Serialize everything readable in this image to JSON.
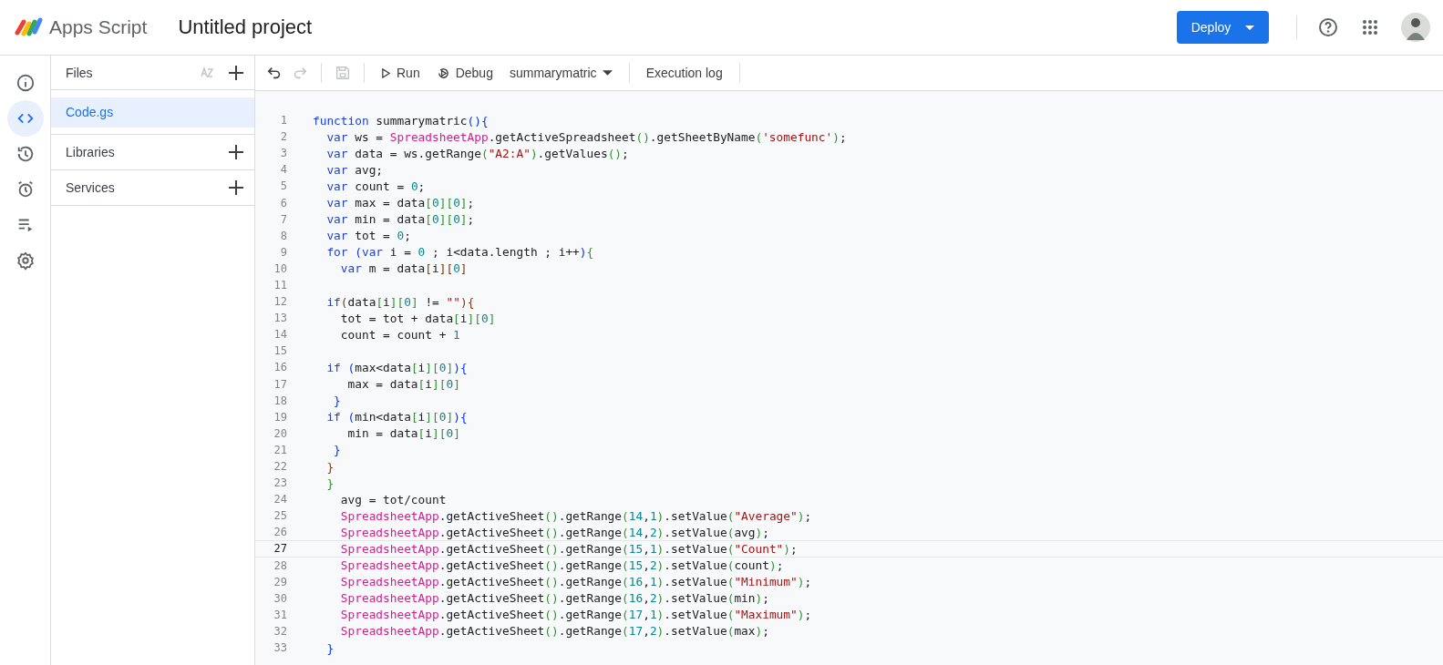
{
  "header": {
    "app_name": "Apps Script",
    "project_title": "Untitled project",
    "deploy_button": "Deploy"
  },
  "rail": [
    {
      "kind": "info",
      "selected": false
    },
    {
      "kind": "code",
      "selected": true
    },
    {
      "kind": "history",
      "selected": false
    },
    {
      "kind": "alarm",
      "selected": false
    },
    {
      "kind": "executions",
      "selected": false
    },
    {
      "kind": "settings",
      "selected": false
    }
  ],
  "files_panel": {
    "title": "Files",
    "files": [
      {
        "name": "Code.gs",
        "selected": true
      }
    ],
    "sections": [
      "Libraries",
      "Services"
    ]
  },
  "toolbar": {
    "undo_disabled": false,
    "redo_disabled": true,
    "save_disabled": true,
    "run": "Run",
    "debug": "Debug",
    "function": "summarymatric",
    "execution_log": "Execution log"
  },
  "code_lines": [
    {
      "number": "1",
      "current": false,
      "tokens": [
        {
          "kind": "keyword",
          "text": "function"
        },
        {
          "kind": "plain",
          "text": " summarymatric"
        },
        {
          "kind": "bracket2",
          "text": "(){"
        }
      ]
    },
    {
      "number": "2",
      "current": false,
      "tokens": [
        {
          "kind": "keyword",
          "text": "  var"
        },
        {
          "kind": "plain",
          "text": " ws = "
        },
        {
          "kind": "class",
          "text": "SpreadsheetApp"
        },
        {
          "kind": "plain",
          "text": ".getActiveSpreadsheet"
        },
        {
          "kind": "bracket1",
          "text": "()"
        },
        {
          "kind": "plain",
          "text": ".getSheetByName"
        },
        {
          "kind": "bracket1",
          "text": "("
        },
        {
          "kind": "string",
          "text": "'somefunc'"
        },
        {
          "kind": "bracket1",
          "text": ")"
        },
        {
          "kind": "plain",
          "text": ";"
        }
      ]
    },
    {
      "number": "3",
      "current": false,
      "tokens": [
        {
          "kind": "keyword",
          "text": "  var"
        },
        {
          "kind": "plain",
          "text": " data = ws.getRange"
        },
        {
          "kind": "bracket1",
          "text": "("
        },
        {
          "kind": "string",
          "text": "\"A2:A\""
        },
        {
          "kind": "bracket1",
          "text": ")"
        },
        {
          "kind": "plain",
          "text": ".getValues"
        },
        {
          "kind": "bracket1",
          "text": "()"
        },
        {
          "kind": "plain",
          "text": ";"
        }
      ]
    },
    {
      "number": "4",
      "current": false,
      "tokens": [
        {
          "kind": "keyword",
          "text": "  var"
        },
        {
          "kind": "plain",
          "text": " avg;"
        }
      ]
    },
    {
      "number": "5",
      "current": false,
      "tokens": [
        {
          "kind": "keyword",
          "text": "  var"
        },
        {
          "kind": "plain",
          "text": " count = "
        },
        {
          "kind": "number",
          "text": "0"
        },
        {
          "kind": "plain",
          "text": ";"
        }
      ]
    },
    {
      "number": "6",
      "current": false,
      "tokens": [
        {
          "kind": "keyword",
          "text": "  var"
        },
        {
          "kind": "plain",
          "text": " max = data"
        },
        {
          "kind": "bracket1",
          "text": "["
        },
        {
          "kind": "number",
          "text": "0"
        },
        {
          "kind": "bracket1",
          "text": "]["
        },
        {
          "kind": "number",
          "text": "0"
        },
        {
          "kind": "bracket1",
          "text": "]"
        },
        {
          "kind": "plain",
          "text": ";"
        }
      ]
    },
    {
      "number": "7",
      "current": false,
      "tokens": [
        {
          "kind": "keyword",
          "text": "  var"
        },
        {
          "kind": "plain",
          "text": " min = data"
        },
        {
          "kind": "bracket1",
          "text": "["
        },
        {
          "kind": "number",
          "text": "0"
        },
        {
          "kind": "bracket1",
          "text": "]["
        },
        {
          "kind": "number",
          "text": "0"
        },
        {
          "kind": "bracket1",
          "text": "]"
        },
        {
          "kind": "plain",
          "text": ";"
        }
      ]
    },
    {
      "number": "8",
      "current": false,
      "tokens": [
        {
          "kind": "keyword",
          "text": "  var"
        },
        {
          "kind": "plain",
          "text": " tot = "
        },
        {
          "kind": "number",
          "text": "0"
        },
        {
          "kind": "plain",
          "text": ";"
        }
      ]
    },
    {
      "number": "9",
      "current": false,
      "tokens": [
        {
          "kind": "keyword",
          "text": "  for"
        },
        {
          "kind": "bracket2",
          "text": " ("
        },
        {
          "kind": "keyword",
          "text": "var"
        },
        {
          "kind": "plain",
          "text": " i = "
        },
        {
          "kind": "number",
          "text": "0"
        },
        {
          "kind": "plain",
          "text": " ; i<data.length ; i++"
        },
        {
          "kind": "bracket2",
          "text": ")"
        },
        {
          "kind": "bracket1",
          "text": "{"
        }
      ]
    },
    {
      "number": "10",
      "current": false,
      "tokens": [
        {
          "kind": "keyword",
          "text": "    var"
        },
        {
          "kind": "plain",
          "text": " m = data"
        },
        {
          "kind": "bracket3",
          "text": "["
        },
        {
          "kind": "plain",
          "text": "i"
        },
        {
          "kind": "bracket3",
          "text": "]["
        },
        {
          "kind": "number",
          "text": "0"
        },
        {
          "kind": "bracket3",
          "text": "]"
        }
      ]
    },
    {
      "number": "11",
      "current": false
    },
    {
      "number": "12",
      "current": false,
      "tokens": [
        {
          "kind": "keyword",
          "text": "  if"
        },
        {
          "kind": "bracket3",
          "text": "("
        },
        {
          "kind": "plain",
          "text": "data"
        },
        {
          "kind": "bracket1",
          "text": "["
        },
        {
          "kind": "plain",
          "text": "i"
        },
        {
          "kind": "bracket1",
          "text": "]["
        },
        {
          "kind": "number",
          "text": "0"
        },
        {
          "kind": "bracket1",
          "text": "]"
        },
        {
          "kind": "plain",
          "text": " != "
        },
        {
          "kind": "string",
          "text": "\"\""
        },
        {
          "kind": "bracket3",
          "text": "){"
        }
      ]
    },
    {
      "number": "13",
      "current": false,
      "tokens": [
        {
          "kind": "plain",
          "text": "    tot = tot + data"
        },
        {
          "kind": "bracket1",
          "text": "["
        },
        {
          "kind": "plain",
          "text": "i"
        },
        {
          "kind": "bracket1",
          "text": "]["
        },
        {
          "kind": "number",
          "text": "0"
        },
        {
          "kind": "bracket1",
          "text": "]"
        }
      ]
    },
    {
      "number": "14",
      "current": false,
      "tokens": [
        {
          "kind": "plain",
          "text": "    count = count + "
        },
        {
          "kind": "number",
          "text": "1"
        }
      ]
    },
    {
      "number": "15",
      "current": false
    },
    {
      "number": "16",
      "current": false,
      "tokens": [
        {
          "kind": "keyword",
          "text": "  if"
        },
        {
          "kind": "bracket2",
          "text": " ("
        },
        {
          "kind": "plain",
          "text": "max<data"
        },
        {
          "kind": "bracket1",
          "text": "["
        },
        {
          "kind": "plain",
          "text": "i"
        },
        {
          "kind": "bracket1",
          "text": "]["
        },
        {
          "kind": "number",
          "text": "0"
        },
        {
          "kind": "bracket1",
          "text": "]"
        },
        {
          "kind": "bracket2",
          "text": "){"
        }
      ]
    },
    {
      "number": "17",
      "current": false,
      "tokens": [
        {
          "kind": "plain",
          "text": "     max = data"
        },
        {
          "kind": "bracket1",
          "text": "["
        },
        {
          "kind": "plain",
          "text": "i"
        },
        {
          "kind": "bracket1",
          "text": "]["
        },
        {
          "kind": "number",
          "text": "0"
        },
        {
          "kind": "bracket1",
          "text": "]"
        }
      ]
    },
    {
      "number": "18",
      "current": false,
      "tokens": [
        {
          "kind": "bracket2",
          "text": "   }"
        }
      ]
    },
    {
      "number": "19",
      "current": false,
      "tokens": [
        {
          "kind": "keyword",
          "text": "  if"
        },
        {
          "kind": "bracket2",
          "text": " ("
        },
        {
          "kind": "plain",
          "text": "min<data"
        },
        {
          "kind": "bracket1",
          "text": "["
        },
        {
          "kind": "plain",
          "text": "i"
        },
        {
          "kind": "bracket1",
          "text": "]["
        },
        {
          "kind": "number",
          "text": "0"
        },
        {
          "kind": "bracket1",
          "text": "]"
        },
        {
          "kind": "bracket2",
          "text": "){"
        }
      ]
    },
    {
      "number": "20",
      "current": false,
      "tokens": [
        {
          "kind": "plain",
          "text": "     min = data"
        },
        {
          "kind": "bracket1",
          "text": "["
        },
        {
          "kind": "plain",
          "text": "i"
        },
        {
          "kind": "bracket1",
          "text": "]["
        },
        {
          "kind": "number",
          "text": "0"
        },
        {
          "kind": "bracket1",
          "text": "]"
        }
      ]
    },
    {
      "number": "21",
      "current": false,
      "tokens": [
        {
          "kind": "bracket2",
          "text": "   }"
        }
      ]
    },
    {
      "number": "22",
      "current": false,
      "tokens": [
        {
          "kind": "bracket3",
          "text": "  }"
        }
      ]
    },
    {
      "number": "23",
      "current": false,
      "tokens": [
        {
          "kind": "bracket1",
          "text": "  }"
        }
      ]
    },
    {
      "number": "24",
      "current": false,
      "tokens": [
        {
          "kind": "plain",
          "text": "    avg = tot/count"
        }
      ]
    },
    {
      "number": "25",
      "current": false,
      "tokens": [
        {
          "kind": "class",
          "text": "    SpreadsheetApp"
        },
        {
          "kind": "plain",
          "text": ".getActiveSheet"
        },
        {
          "kind": "bracket1",
          "text": "()"
        },
        {
          "kind": "plain",
          "text": ".getRange"
        },
        {
          "kind": "bracket1",
          "text": "("
        },
        {
          "kind": "number",
          "text": "14"
        },
        {
          "kind": "plain",
          "text": ","
        },
        {
          "kind": "number",
          "text": "1"
        },
        {
          "kind": "bracket1",
          "text": ")"
        },
        {
          "kind": "plain",
          "text": ".setValue"
        },
        {
          "kind": "bracket1",
          "text": "("
        },
        {
          "kind": "string",
          "text": "\"Average\""
        },
        {
          "kind": "bracket1",
          "text": ")"
        },
        {
          "kind": "plain",
          "text": ";"
        }
      ]
    },
    {
      "number": "26",
      "current": false,
      "tokens": [
        {
          "kind": "class",
          "text": "    SpreadsheetApp"
        },
        {
          "kind": "plain",
          "text": ".getActiveSheet"
        },
        {
          "kind": "bracket1",
          "text": "()"
        },
        {
          "kind": "plain",
          "text": ".getRange"
        },
        {
          "kind": "bracket1",
          "text": "("
        },
        {
          "kind": "number",
          "text": "14"
        },
        {
          "kind": "plain",
          "text": ","
        },
        {
          "kind": "number",
          "text": "2"
        },
        {
          "kind": "bracket1",
          "text": ")"
        },
        {
          "kind": "plain",
          "text": ".setValue"
        },
        {
          "kind": "bracket1",
          "text": "("
        },
        {
          "kind": "plain",
          "text": "avg"
        },
        {
          "kind": "bracket1",
          "text": ")"
        },
        {
          "kind": "plain",
          "text": ";"
        }
      ]
    },
    {
      "number": "27",
      "current": true,
      "tokens": [
        {
          "kind": "class",
          "text": "    SpreadsheetApp"
        },
        {
          "kind": "plain",
          "text": ".getActiveSheet"
        },
        {
          "kind": "bracket1",
          "text": "()"
        },
        {
          "kind": "plain",
          "text": ".getRange"
        },
        {
          "kind": "bracket1",
          "text": "("
        },
        {
          "kind": "number",
          "text": "15"
        },
        {
          "kind": "plain",
          "text": ","
        },
        {
          "kind": "number",
          "text": "1"
        },
        {
          "kind": "bracket1",
          "text": ")"
        },
        {
          "kind": "plain",
          "text": ".setValue"
        },
        {
          "kind": "bracket1",
          "text": "("
        },
        {
          "kind": "string",
          "text": "\"Count\""
        },
        {
          "kind": "bracket1",
          "text": ")"
        },
        {
          "kind": "plain",
          "text": ";"
        }
      ]
    },
    {
      "number": "28",
      "current": false,
      "tokens": [
        {
          "kind": "class",
          "text": "    SpreadsheetApp"
        },
        {
          "kind": "plain",
          "text": ".getActiveSheet"
        },
        {
          "kind": "bracket1",
          "text": "()"
        },
        {
          "kind": "plain",
          "text": ".getRange"
        },
        {
          "kind": "bracket1",
          "text": "("
        },
        {
          "kind": "number",
          "text": "15"
        },
        {
          "kind": "plain",
          "text": ","
        },
        {
          "kind": "number",
          "text": "2"
        },
        {
          "kind": "bracket1",
          "text": ")"
        },
        {
          "kind": "plain",
          "text": ".setValue"
        },
        {
          "kind": "bracket1",
          "text": "("
        },
        {
          "kind": "plain",
          "text": "count"
        },
        {
          "kind": "bracket1",
          "text": ")"
        },
        {
          "kind": "plain",
          "text": ";"
        }
      ]
    },
    {
      "number": "29",
      "current": false,
      "tokens": [
        {
          "kind": "class",
          "text": "    SpreadsheetApp"
        },
        {
          "kind": "plain",
          "text": ".getActiveSheet"
        },
        {
          "kind": "bracket1",
          "text": "()"
        },
        {
          "kind": "plain",
          "text": ".getRange"
        },
        {
          "kind": "bracket1",
          "text": "("
        },
        {
          "kind": "number",
          "text": "16"
        },
        {
          "kind": "plain",
          "text": ","
        },
        {
          "kind": "number",
          "text": "1"
        },
        {
          "kind": "bracket1",
          "text": ")"
        },
        {
          "kind": "plain",
          "text": ".setValue"
        },
        {
          "kind": "bracket1",
          "text": "("
        },
        {
          "kind": "string",
          "text": "\"Minimum\""
        },
        {
          "kind": "bracket1",
          "text": ")"
        },
        {
          "kind": "plain",
          "text": ";"
        }
      ]
    },
    {
      "number": "30",
      "current": false,
      "tokens": [
        {
          "kind": "class",
          "text": "    SpreadsheetApp"
        },
        {
          "kind": "plain",
          "text": ".getActiveSheet"
        },
        {
          "kind": "bracket1",
          "text": "()"
        },
        {
          "kind": "plain",
          "text": ".getRange"
        },
        {
          "kind": "bracket1",
          "text": "("
        },
        {
          "kind": "number",
          "text": "16"
        },
        {
          "kind": "plain",
          "text": ","
        },
        {
          "kind": "number",
          "text": "2"
        },
        {
          "kind": "bracket1",
          "text": ")"
        },
        {
          "kind": "plain",
          "text": ".setValue"
        },
        {
          "kind": "bracket1",
          "text": "("
        },
        {
          "kind": "plain",
          "text": "min"
        },
        {
          "kind": "bracket1",
          "text": ")"
        },
        {
          "kind": "plain",
          "text": ";"
        }
      ]
    },
    {
      "number": "31",
      "current": false,
      "tokens": [
        {
          "kind": "class",
          "text": "    SpreadsheetApp"
        },
        {
          "kind": "plain",
          "text": ".getActiveSheet"
        },
        {
          "kind": "bracket1",
          "text": "()"
        },
        {
          "kind": "plain",
          "text": ".getRange"
        },
        {
          "kind": "bracket1",
          "text": "("
        },
        {
          "kind": "number",
          "text": "17"
        },
        {
          "kind": "plain",
          "text": ","
        },
        {
          "kind": "number",
          "text": "1"
        },
        {
          "kind": "bracket1",
          "text": ")"
        },
        {
          "kind": "plain",
          "text": ".setValue"
        },
        {
          "kind": "bracket1",
          "text": "("
        },
        {
          "kind": "string",
          "text": "\"Maximum\""
        },
        {
          "kind": "bracket1",
          "text": ")"
        },
        {
          "kind": "plain",
          "text": ";"
        }
      ]
    },
    {
      "number": "32",
      "current": false,
      "tokens": [
        {
          "kind": "class",
          "text": "    SpreadsheetApp"
        },
        {
          "kind": "plain",
          "text": ".getActiveSheet"
        },
        {
          "kind": "bracket1",
          "text": "()"
        },
        {
          "kind": "plain",
          "text": ".getRange"
        },
        {
          "kind": "bracket1",
          "text": "("
        },
        {
          "kind": "number",
          "text": "17"
        },
        {
          "kind": "plain",
          "text": ","
        },
        {
          "kind": "number",
          "text": "2"
        },
        {
          "kind": "bracket1",
          "text": ")"
        },
        {
          "kind": "plain",
          "text": ".setValue"
        },
        {
          "kind": "bracket1",
          "text": "("
        },
        {
          "kind": "plain",
          "text": "max"
        },
        {
          "kind": "bracket1",
          "text": ")"
        },
        {
          "kind": "plain",
          "text": ";"
        }
      ]
    },
    {
      "number": "33",
      "current": false,
      "tokens": [
        {
          "kind": "bracket2",
          "text": "  }"
        }
      ]
    }
  ]
}
